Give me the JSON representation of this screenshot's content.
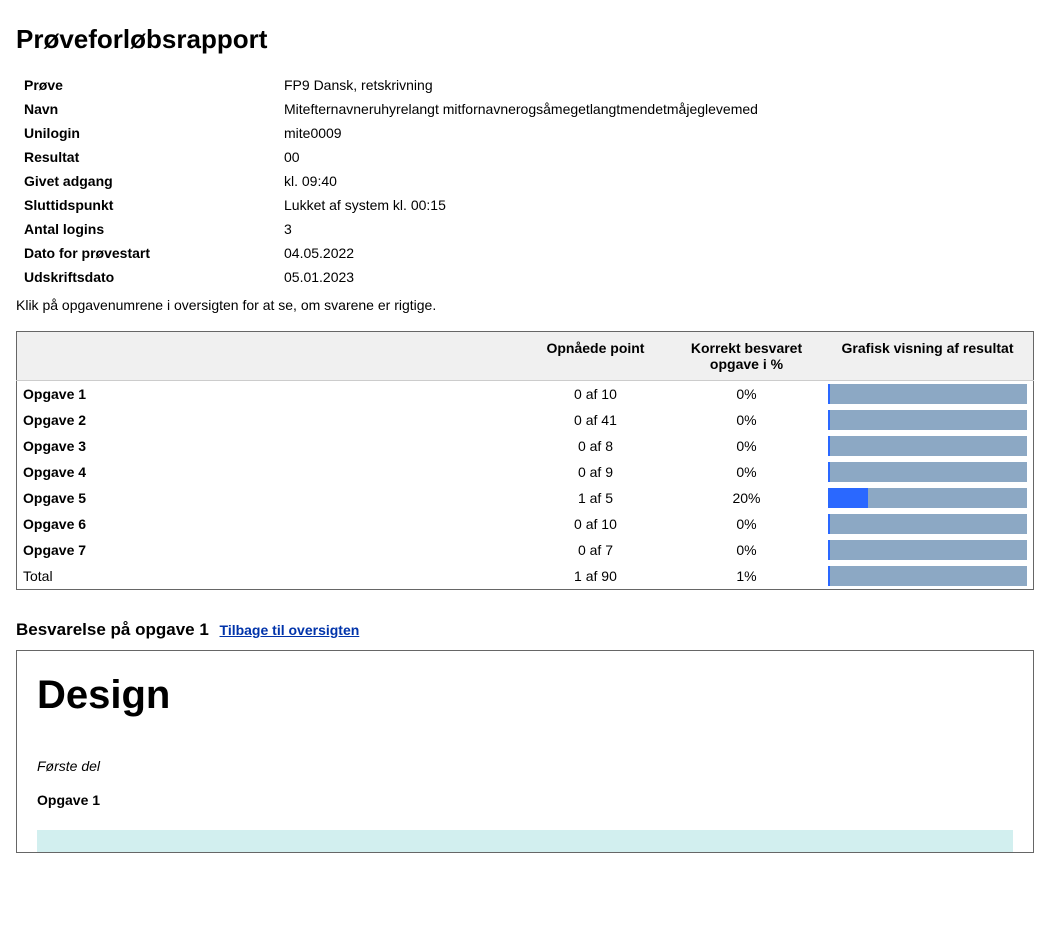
{
  "title": "Prøveforløbsrapport",
  "meta": {
    "labels": {
      "exam": "Prøve",
      "name": "Navn",
      "unilogin": "Unilogin",
      "result": "Resultat",
      "access": "Givet adgang",
      "end": "Sluttidspunkt",
      "logins": "Antal logins",
      "start_date": "Dato for prøvestart",
      "print_date": "Udskriftsdato"
    },
    "values": {
      "exam": "FP9 Dansk, retskrivning",
      "name": "Mitefternavneruhyrelangt mitfornavnerogsåmegetlangtmendetmåjeglevemed",
      "unilogin": "mite0009",
      "result": "00",
      "access": "kl. 09:40",
      "end": "Lukket af system kl. 00:15",
      "logins": "3",
      "start_date": "04.05.2022",
      "print_date": "05.01.2023"
    }
  },
  "instruction": "Klik på opgavenumrene i oversigten for at se, om svarene er rigtige.",
  "table": {
    "headers": {
      "task": "",
      "points": "Opnåede point",
      "percent": "Korrekt besvaret opgave i %",
      "graph": "Grafisk visning af resultat"
    },
    "rows": [
      {
        "label": "Opgave 1",
        "points": "0 af 10",
        "percent": "0%",
        "fill": 0
      },
      {
        "label": "Opgave 2",
        "points": "0 af 41",
        "percent": "0%",
        "fill": 0
      },
      {
        "label": "Opgave 3",
        "points": "0 af 8",
        "percent": "0%",
        "fill": 0
      },
      {
        "label": "Opgave 4",
        "points": "0 af 9",
        "percent": "0%",
        "fill": 0
      },
      {
        "label": "Opgave 5",
        "points": "1 af 5",
        "percent": "20%",
        "fill": 20
      },
      {
        "label": "Opgave 6",
        "points": "0 af 10",
        "percent": "0%",
        "fill": 0
      },
      {
        "label": "Opgave 7",
        "points": "0 af 7",
        "percent": "0%",
        "fill": 0
      },
      {
        "label": "Total",
        "points": "1 af 90",
        "percent": "1%",
        "fill": 1
      }
    ]
  },
  "answer": {
    "header": "Besvarelse på opgave 1",
    "back_link": "Tilbage til oversigten",
    "design_title": "Design",
    "part_label": "Første del",
    "task_label": "Opgave 1"
  },
  "chart_data": {
    "type": "bar",
    "title": "Grafisk visning af resultat",
    "xlabel": "",
    "ylabel": "Korrekt besvaret opgave i %",
    "ylim": [
      0,
      100
    ],
    "categories": [
      "Opgave 1",
      "Opgave 2",
      "Opgave 3",
      "Opgave 4",
      "Opgave 5",
      "Opgave 6",
      "Opgave 7",
      "Total"
    ],
    "values": [
      0,
      0,
      0,
      0,
      20,
      0,
      0,
      1
    ]
  },
  "colors": {
    "bar_bg": "#8ca8c4",
    "bar_fill": "#2a68ff",
    "header_bg": "#f0f0f0",
    "link": "#0033aa",
    "strip": "#d2efef"
  }
}
